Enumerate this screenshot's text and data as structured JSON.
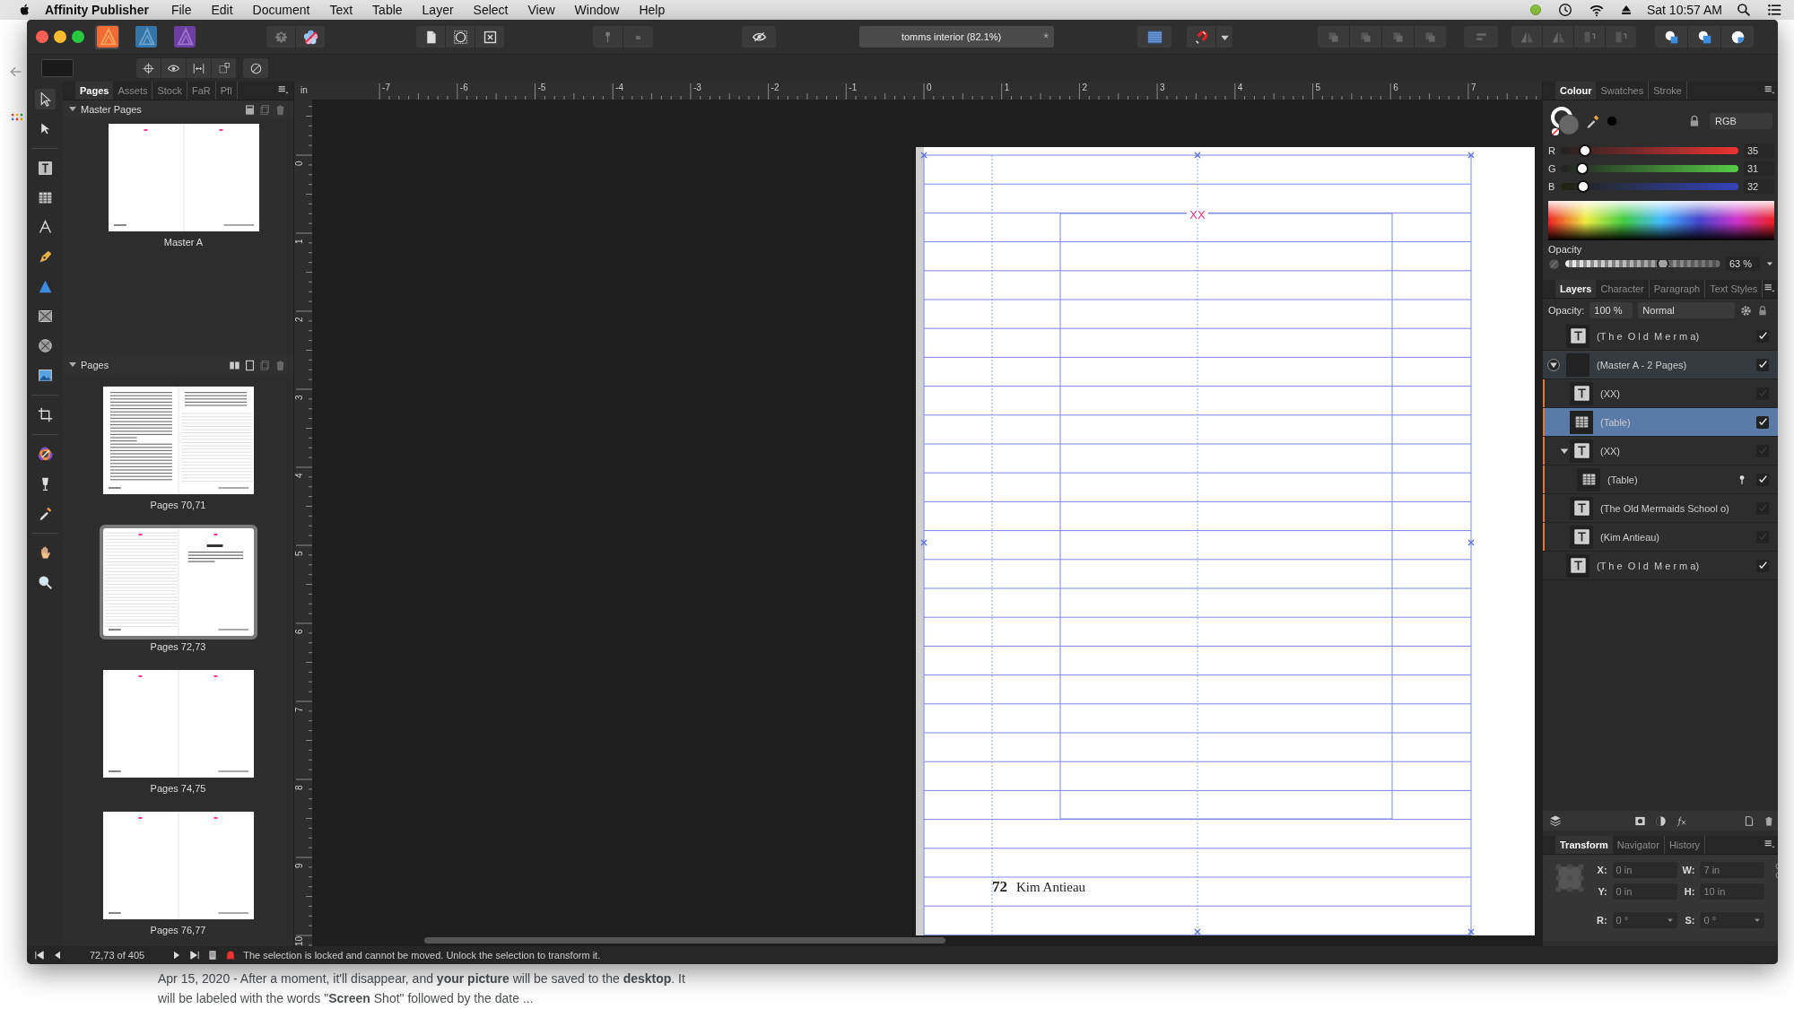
{
  "menubar": {
    "app_name": "Affinity Publisher",
    "menus": [
      "File",
      "Edit",
      "Document",
      "Text",
      "Table",
      "Layer",
      "Select",
      "View",
      "Window",
      "Help"
    ],
    "clock": "Sat 10:57 AM"
  },
  "toolbar": {
    "document_title": "tomms interior (82.1%)",
    "modified_mark": "*"
  },
  "left_panel": {
    "tabs": [
      {
        "label": "Pages",
        "selected": true
      },
      {
        "label": "Assets",
        "selected": false
      },
      {
        "label": "Stock",
        "selected": false
      },
      {
        "label": "FaR",
        "selected": false
      },
      {
        "label": "Pfl",
        "selected": false
      }
    ],
    "master_pages": {
      "title": "Master Pages",
      "items": [
        {
          "label": "Master A",
          "kind": "blank",
          "selected": false
        }
      ]
    },
    "pages": {
      "title": "Pages",
      "items": [
        {
          "label": "Pages 70,71",
          "kind": "text",
          "selected": false
        },
        {
          "label": "Pages 72,73",
          "kind": "poem",
          "selected": true
        },
        {
          "label": "Pages 74,75",
          "kind": "blank",
          "selected": false
        },
        {
          "label": "Pages 76,77",
          "kind": "blank",
          "selected": false
        }
      ]
    }
  },
  "rulers": {
    "unit": "in",
    "horizontal": [
      "-7",
      "-6",
      "-5",
      "-4",
      "-3",
      "-2",
      "-1",
      "0",
      "1",
      "2",
      "3",
      "4",
      "5",
      "6",
      "7"
    ],
    "vertical": [
      "0",
      "1",
      "2",
      "3",
      "4",
      "5",
      "6",
      "7",
      "8",
      "9",
      "10"
    ]
  },
  "page": {
    "header": "XX",
    "page_number": "72",
    "author": "Kim Antieau"
  },
  "colour_panel": {
    "tabs": [
      {
        "label": "Colour",
        "selected": true
      },
      {
        "label": "Swatches",
        "selected": false
      },
      {
        "label": "Stroke",
        "selected": false
      }
    ],
    "model": "RGB",
    "channels": [
      {
        "name": "R",
        "level": 0.137,
        "reading": "35"
      },
      {
        "name": "G",
        "level": 0.122,
        "reading": "31"
      },
      {
        "name": "B",
        "level": 0.125,
        "reading": "32"
      }
    ],
    "opacity_label": "Opacity",
    "opacity": {
      "level": 0.63,
      "reading": "63 %"
    }
  },
  "layers_panel": {
    "tabs": [
      {
        "label": "Layers",
        "selected": true
      },
      {
        "label": "Character",
        "selected": false
      },
      {
        "label": "Paragraph",
        "selected": false
      },
      {
        "label": "Text Styles",
        "selected": false
      }
    ],
    "opacity_label": "Opacity:",
    "opacity": "100 %",
    "blend_mode": "Normal",
    "layers": [
      {
        "name": "(T h e  O l d  M e r m a)",
        "kind": "text",
        "selected": false,
        "checked": true
      },
      {
        "name": "(Master A - 2 Pages)",
        "kind": "master",
        "selected": false,
        "checked": true,
        "expanded": true,
        "children": [
          {
            "name": "(XX)",
            "kind": "text",
            "selected": false,
            "checked": false
          },
          {
            "name": "(Table)",
            "kind": "table",
            "selected": true,
            "checked": true
          },
          {
            "name": "(XX)",
            "kind": "text",
            "selected": false,
            "checked": false,
            "expanded": true,
            "children": [
              {
                "name": "(Table)",
                "kind": "table",
                "selected": false,
                "checked": true,
                "pinned": true
              }
            ]
          },
          {
            "name": "(The Old Mermaids School o)",
            "kind": "text",
            "selected": false,
            "checked": false
          },
          {
            "name": "(Kim Antieau)",
            "kind": "text",
            "selected": false,
            "checked": false
          }
        ]
      },
      {
        "name": "(T h e  O l d  M e r m a)",
        "kind": "text",
        "selected": false,
        "checked": true
      }
    ]
  },
  "transform_panel": {
    "tabs": [
      {
        "label": "Transform",
        "selected": true
      },
      {
        "label": "Navigator",
        "selected": false
      },
      {
        "label": "History",
        "selected": false
      }
    ],
    "fields": [
      {
        "label": "X:",
        "value": "0 in",
        "kind": "plain"
      },
      {
        "label": "W:",
        "value": "7 in",
        "kind": "plain"
      },
      {
        "label": "Y:",
        "value": "0 in",
        "kind": "plain"
      },
      {
        "label": "H:",
        "value": "10 in",
        "kind": "plain"
      },
      {
        "label": "R:",
        "value": "0 °",
        "kind": "dropdown"
      },
      {
        "label": "S:",
        "value": "0 °",
        "kind": "dropdown"
      }
    ]
  },
  "status_bar": {
    "page_counter": "72,73 of 405",
    "message": "The selection is locked and cannot be moved. Unlock the selection to transform it."
  },
  "background_page": {
    "snippet": "Apr 15, 2020 - After a moment, it'll disappear, and **your picture** will be saved to the **desktop**. It will be labeled with the words \"**Screen** Shot\" followed by the date ..."
  }
}
